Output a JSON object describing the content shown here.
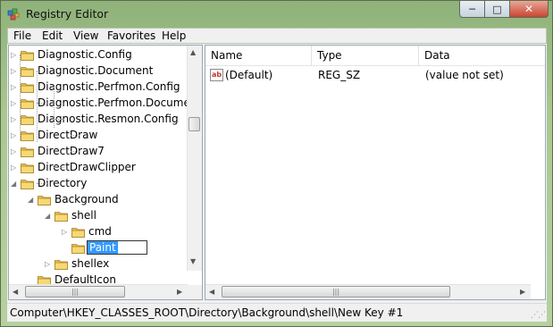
{
  "window": {
    "title": "Registry Editor",
    "icon": "registry-cube-icon"
  },
  "caption": {
    "minimize": "─",
    "maximize": "□",
    "close": "✕"
  },
  "menu": [
    "File",
    "Edit",
    "View",
    "Favorites",
    "Help"
  ],
  "tree": {
    "items": [
      {
        "label": "Diagnostic.Config",
        "expander": "▷"
      },
      {
        "label": "Diagnostic.Document",
        "expander": "▷"
      },
      {
        "label": "Diagnostic.Perfmon.Config",
        "expander": "▷"
      },
      {
        "label": "Diagnostic.Perfmon.Documen",
        "expander": "▷"
      },
      {
        "label": "Diagnostic.Resmon.Config",
        "expander": "▷"
      },
      {
        "label": "DirectDraw",
        "expander": "▷"
      },
      {
        "label": "DirectDraw7",
        "expander": "▷"
      },
      {
        "label": "DirectDrawClipper",
        "expander": "▷"
      },
      {
        "label": "Directory",
        "expander": "◢"
      },
      {
        "label": "Background",
        "expander": "◢"
      },
      {
        "label": "shell",
        "expander": "◢"
      },
      {
        "label": "cmd",
        "expander": "▷"
      },
      {
        "label": "Paint",
        "expander": "",
        "editing": true
      },
      {
        "label": "shellex",
        "expander": "▷"
      },
      {
        "label": "DefaultIcon",
        "expander": ""
      }
    ]
  },
  "list": {
    "columns": [
      "Name",
      "Type",
      "Data"
    ],
    "rows": [
      {
        "icon": "ab",
        "name": "(Default)",
        "type": "REG_SZ",
        "data": "(value not set)"
      }
    ]
  },
  "status": {
    "path": "Computer\\HKEY_CLASSES_ROOT\\Directory\\Background\\shell\\New Key #1"
  }
}
